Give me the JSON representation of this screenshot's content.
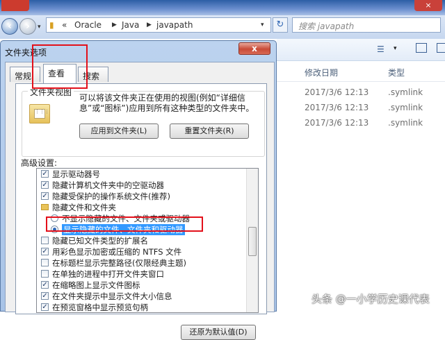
{
  "explorer": {
    "close_glyph": "×",
    "path": [
      "Oracle",
      "Java",
      "javapath"
    ],
    "path_prefix": "«",
    "search_placeholder": "搜索 javapath",
    "columns": {
      "date": "修改日期",
      "type": "类型"
    },
    "rows": [
      {
        "date": "2017/3/6 12:13",
        "type": ".symlink"
      },
      {
        "date": "2017/3/6 12:13",
        "type": ".symlink"
      },
      {
        "date": "2017/3/6 12:13",
        "type": ".symlink"
      }
    ]
  },
  "dialog": {
    "title": "文件夹选项",
    "close_glyph": "x",
    "tabs": [
      "常规",
      "查看",
      "搜索"
    ],
    "active_tab": "查看",
    "folder_views": {
      "legend": "文件夹视图",
      "description": "可以将该文件夹正在使用的视图(例如“详细信息”或“图标”)应用到所有这种类型的文件夹中。",
      "apply_button": "应用到文件夹(L)",
      "reset_button": "重置文件夹(R)"
    },
    "advanced_label": "高级设置:",
    "settings": [
      {
        "kind": "checkbox",
        "checked": true,
        "label": "显示驱动器号"
      },
      {
        "kind": "checkbox",
        "checked": true,
        "label": "隐藏计算机文件夹中的空驱动器"
      },
      {
        "kind": "checkbox",
        "checked": true,
        "label": "隐藏受保护的操作系统文件(推荐)"
      },
      {
        "kind": "folder",
        "label": "隐藏文件和文件夹"
      },
      {
        "kind": "radio",
        "checked": false,
        "label": "不显示隐藏的文件、文件夹或驱动器"
      },
      {
        "kind": "radio",
        "checked": true,
        "label": "显示隐藏的文件、文件夹和驱动器"
      },
      {
        "kind": "checkbox",
        "checked": false,
        "label": "隐藏已知文件类型的扩展名"
      },
      {
        "kind": "checkbox",
        "checked": true,
        "label": "用彩色显示加密或压缩的 NTFS 文件"
      },
      {
        "kind": "checkbox",
        "checked": false,
        "label": "在标题栏显示完整路径(仅限经典主题)"
      },
      {
        "kind": "checkbox",
        "checked": false,
        "label": "在单独的进程中打开文件夹窗口"
      },
      {
        "kind": "checkbox",
        "checked": true,
        "label": "在缩略图上显示文件图标"
      },
      {
        "kind": "checkbox",
        "checked": true,
        "label": "在文件夹提示中显示文件大小信息"
      },
      {
        "kind": "checkbox",
        "checked": true,
        "label": "在预览窗格中显示预览句柄"
      }
    ],
    "restore_button": "还原为默认值(D)"
  },
  "watermark": "头条 @一小学历史课代表",
  "highlight_color": "#e3101a"
}
